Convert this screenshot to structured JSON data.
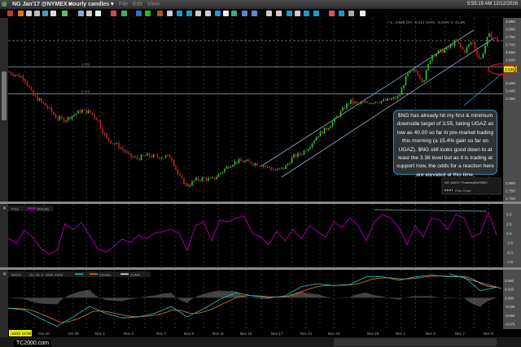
{
  "window": {
    "symbol": "NG Jan'17 @NYMEX",
    "timeframe": "Hourly candles",
    "menu": [
      "File",
      "Edit",
      "View"
    ],
    "clock": "5:55:19 AM 12/12/2016"
  },
  "info_line": "L: 3.635  CH: -0.211  CH%: -5.83%  V: 41.2K",
  "price_axis": {
    "labels": [
      "3.850",
      "3.800",
      "3.750",
      "3.700",
      "3.650",
      "3.600",
      "3.550",
      "3.450",
      "3.400",
      "3.350",
      "2.800",
      "2.750",
      "2.700"
    ],
    "last_price": "3.538",
    "last_price_color": "#e8e800"
  },
  "levels": [
    {
      "label": "3.553",
      "value": 3.553
    },
    {
      "label": "3.378",
      "value": 3.378
    }
  ],
  "legend": {
    "series": "NG JAN'17 Futures@NYMEX",
    "prior_close": "Prior Close"
  },
  "annotation": "$NG has already hit my first & minimum downside target of 3.55, taking UGAZ as low as 40.00 so far in pre-market trading this morning (a 15.4% gain so far on UGAZ). $NG still looks good down to at least the 3.38 level but as it is trading at support now, the odds for a reaction here are elevated at this time.",
  "roc_panel": {
    "legend": [
      "Price",
      "ROC(8)"
    ],
    "axis_labels": [
      "5.0",
      "2.5",
      "0.0",
      "-2.5",
      "-5.0",
      "-7.5"
    ],
    "line_color": "#b000b0"
  },
  "macd_panel": {
    "legend": [
      "MACD",
      "(12, 26, 9 - EMA, EMA)",
      "SIGNAL",
      "OSMA"
    ],
    "axis_labels": [
      "0.050",
      "0.025",
      "0.000",
      "-0.025",
      "-0.050",
      "-0.075"
    ],
    "macd_color": "#1fb5b0",
    "signal_color": "#c87028",
    "osma_color": "#e0e0e0"
  },
  "x_axis": {
    "labels": [
      "10/21 12:00",
      "Oct 26",
      "Oct 28",
      "Nov 1",
      "Nov 3",
      "Nov 7",
      "Nov 9",
      "Nov 11",
      "Nov 15",
      "Nov 17",
      "Nov 21",
      "Nov 23",
      "Nov 29",
      "Dec 1",
      "Dec 5",
      "Dec 7",
      "Dec 9"
    ]
  },
  "watermark": "TC2000.com",
  "colors": {
    "up": "#22cc22",
    "down": "#dd1111",
    "channel": "#8fb0c8",
    "level": "#7f93a8",
    "target_circle": "#e01010"
  },
  "chart_data": {
    "type": "candlestick",
    "price_closes": [
      3.52,
      3.5,
      3.48,
      3.37,
      3.33,
      3.28,
      3.22,
      3.21,
      3.24,
      3.27,
      3.26,
      3.21,
      3.09,
      3.06,
      3.02,
      2.97,
      2.96,
      2.98,
      2.97,
      2.97,
      2.97,
      2.84,
      2.78,
      2.82,
      2.83,
      2.82,
      2.86,
      2.91,
      2.94,
      2.94,
      2.93,
      2.92,
      2.9,
      2.88,
      2.9,
      2.97,
      2.99,
      3.04,
      3.11,
      3.15,
      3.2,
      3.27,
      3.33,
      3.31,
      3.32,
      3.33,
      3.33,
      3.34,
      3.36,
      3.5,
      3.53,
      3.46,
      3.63,
      3.65,
      3.67,
      3.72,
      3.65,
      3.72,
      3.59,
      3.76,
      3.73
    ],
    "price_range": [
      2.68,
      3.87
    ],
    "roc": [
      -1.3,
      -2.6,
      0.8,
      -1,
      -4,
      -5.5,
      -4.5,
      2.5,
      1,
      2.8,
      -0.5,
      -4,
      -5,
      -3.5,
      -1.5,
      -2.5,
      -0.5,
      -1.5,
      0,
      0.5,
      1,
      0,
      -4.5,
      2,
      3,
      -2,
      3.5,
      3,
      4,
      4.5,
      0,
      -1,
      -3,
      0.5,
      -2,
      1,
      -1.5,
      2,
      0.5,
      -1,
      3,
      1.5,
      4,
      2,
      -2,
      3,
      5,
      4,
      1.5,
      -3,
      2,
      -1,
      4,
      3.5,
      1,
      5,
      4,
      -1,
      0,
      5.5,
      -0.5
    ],
    "roc_range": [
      -9,
      7.5
    ],
    "macd": [
      -0.03,
      -0.035,
      -0.06,
      -0.082,
      -0.055,
      -0.025,
      -0.045,
      -0.058,
      -0.055,
      -0.045,
      -0.025,
      -0.055,
      -0.032,
      -0.005,
      0.015,
      0.005,
      0.0,
      0.005,
      0.032,
      0.04,
      0.035,
      0.038,
      0.06,
      0.06,
      0.05,
      0.06,
      0.065,
      0.06,
      0.06,
      0.02,
      0.03
    ],
    "macd_range": [
      -0.09,
      0.08
    ]
  }
}
